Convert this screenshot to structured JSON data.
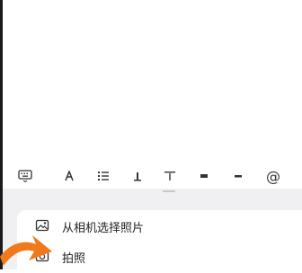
{
  "toolbar": {
    "items": [
      {
        "icon": "keyboard-icon"
      },
      {
        "icon": "text-style-icon"
      },
      {
        "icon": "list-icon"
      },
      {
        "icon": "align-left-icon"
      },
      {
        "icon": "divider-icon"
      },
      {
        "icon": "image-icon"
      },
      {
        "icon": "more-icon"
      },
      {
        "icon": "mention-icon",
        "label": "@"
      }
    ]
  },
  "menu": {
    "items": [
      {
        "icon": "photo-icon",
        "label": "从相机选择照片"
      },
      {
        "icon": "camera-icon",
        "label": "拍照"
      }
    ]
  },
  "colors": {
    "sheet_bg": "#f0f0f2",
    "arrow": "#f07a1a"
  }
}
